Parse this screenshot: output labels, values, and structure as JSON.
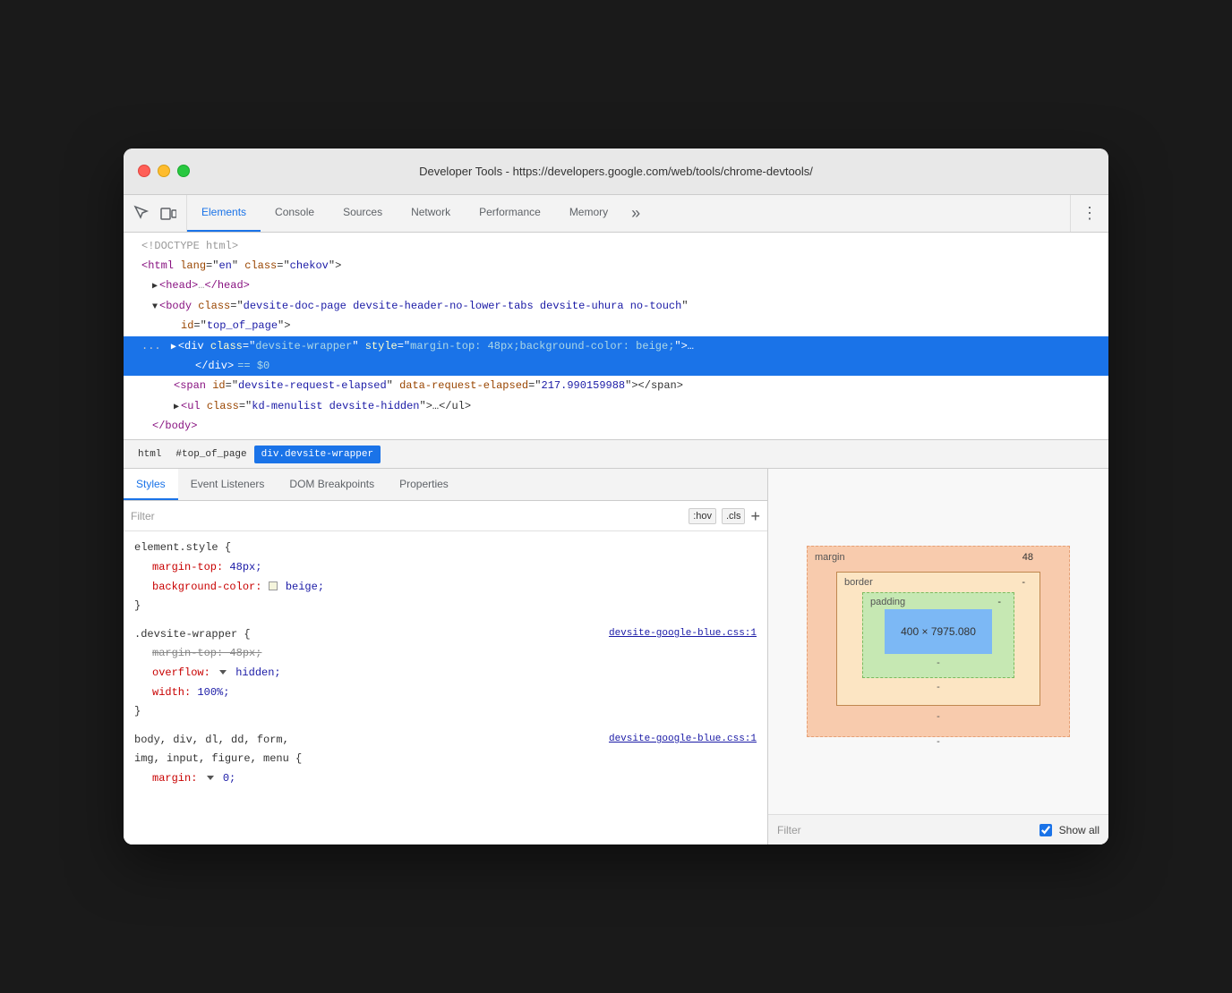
{
  "window": {
    "title": "Developer Tools - https://developers.google.com/web/tools/chrome-devtools/"
  },
  "tabs": {
    "items": [
      {
        "id": "elements",
        "label": "Elements",
        "active": true
      },
      {
        "id": "console",
        "label": "Console",
        "active": false
      },
      {
        "id": "sources",
        "label": "Sources",
        "active": false
      },
      {
        "id": "network",
        "label": "Network",
        "active": false
      },
      {
        "id": "performance",
        "label": "Performance",
        "active": false
      },
      {
        "id": "memory",
        "label": "Memory",
        "active": false
      }
    ],
    "more_label": "»",
    "menu_label": "⋮"
  },
  "dom_lines": [
    {
      "id": "doctype",
      "content": "<!DOCTYPE html>",
      "type": "comment",
      "indent": 0
    },
    {
      "id": "html-open",
      "content": "<html lang=\"en\" class=\"chekov\">",
      "type": "tag",
      "indent": 0
    },
    {
      "id": "head",
      "content": "▶<head>…</head>",
      "type": "tag",
      "indent": 1
    },
    {
      "id": "body",
      "content": "▼<body class=\"devsite-doc-page devsite-header-no-lower-tabs devsite-uhura no-touch\"",
      "type": "tag",
      "indent": 1
    },
    {
      "id": "body-id",
      "content": "id=\"top_of_page\">",
      "type": "tag",
      "indent": 2
    },
    {
      "id": "div-selected",
      "content": "… ▶<div class=\"devsite-wrapper\" style=\"margin-top: 48px;background-color: beige;\">…",
      "type": "tag-selected",
      "indent": 2
    },
    {
      "id": "div-close",
      "content": "</div> == $0",
      "type": "tag-selected",
      "indent": 3
    },
    {
      "id": "span",
      "content": "<span id=\"devsite-request-elapsed\" data-request-elapsed=\"217.990159988\"></span>",
      "type": "tag",
      "indent": 3
    },
    {
      "id": "ul",
      "content": "▶<ul class=\"kd-menulist devsite-hidden\">…</ul>",
      "type": "tag",
      "indent": 3
    },
    {
      "id": "body-close",
      "content": "</body>",
      "type": "tag",
      "indent": 1
    }
  ],
  "breadcrumbs": [
    {
      "id": "bc-html",
      "label": "html",
      "active": false
    },
    {
      "id": "bc-top",
      "label": "#top_of_page",
      "active": false
    },
    {
      "id": "bc-div",
      "label": "div.devsite-wrapper",
      "active": true
    }
  ],
  "panel_tabs": [
    {
      "id": "styles",
      "label": "Styles",
      "active": true
    },
    {
      "id": "event-listeners",
      "label": "Event Listeners",
      "active": false
    },
    {
      "id": "dom-breakpoints",
      "label": "DOM Breakpoints",
      "active": false
    },
    {
      "id": "properties",
      "label": "Properties",
      "active": false
    }
  ],
  "filter": {
    "placeholder": "Filter",
    "hov_label": ":hov",
    "cls_label": ".cls",
    "add_label": "+"
  },
  "css_rules": [
    {
      "id": "element-style",
      "selector": "element.style {",
      "properties": [
        {
          "prop": "margin-top:",
          "value": "48px;",
          "struck": false
        },
        {
          "prop": "background-color:",
          "value": "beige;",
          "struck": false,
          "has_swatch": true,
          "swatch_color": "#f5f5dc"
        }
      ],
      "close": "}"
    },
    {
      "id": "devsite-wrapper",
      "selector": ".devsite-wrapper {",
      "file_link": "devsite-google-blue.css:1",
      "properties": [
        {
          "prop": "margin-top:",
          "value": "48px;",
          "struck": true
        },
        {
          "prop": "overflow:",
          "value": "hidden;",
          "struck": false,
          "has_triangle": true
        },
        {
          "prop": "width:",
          "value": "100%;",
          "struck": false
        }
      ],
      "close": "}"
    },
    {
      "id": "body-rule",
      "selector": "body, div, dl, dd, form,",
      "file_link": "devsite-google-blue.css:1",
      "selector2": "img, input, figure, menu {",
      "properties": [
        {
          "prop": "margin:",
          "value": "0;",
          "struck": false,
          "has_triangle": true
        }
      ]
    }
  ],
  "box_model": {
    "margin_label": "margin",
    "margin_value": "48",
    "border_label": "border",
    "border_value": "-",
    "padding_label": "padding",
    "padding_value": "-",
    "content_value": "400 × 7975.080",
    "side_top": "-",
    "side_bottom": "-",
    "side_left": "-",
    "side_right": "-"
  },
  "bottom_filter": {
    "placeholder": "Filter",
    "show_all_label": "Show all"
  }
}
